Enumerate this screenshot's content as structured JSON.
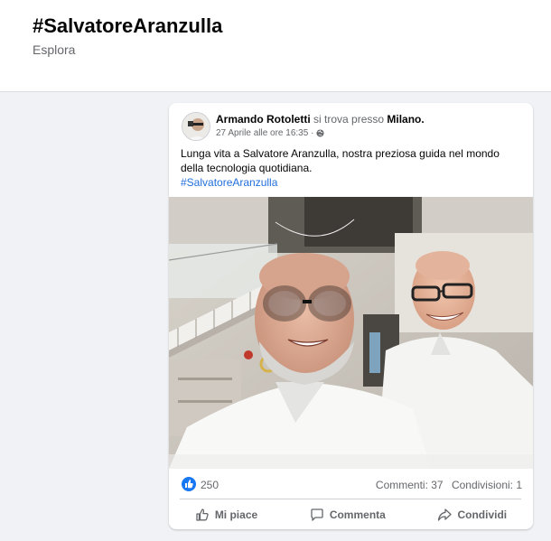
{
  "page": {
    "title": "#SalvatoreAranzulla",
    "subtitle": "Esplora"
  },
  "post": {
    "author": "Armando Rotoletti",
    "location_prefix": "si trova presso",
    "location": "Milano.",
    "timestamp": "27 Aprile alle ore 16:35 ·",
    "privacy_icon": "globe-icon",
    "text": "Lunga vita a Salvatore Aranzulla, nostra preziosa guida nel mondo della tecnologia quotidiana.",
    "hashtag": "#SalvatoreAranzulla",
    "photo_icon": "selfie-photo",
    "reactions_count": "250",
    "comments": "Commenti: 37",
    "shares": "Condivisioni: 1",
    "actions": {
      "like": "Mi piace",
      "comment": "Commenta",
      "share": "Condividi"
    }
  },
  "colors": {
    "background": "#f0f2f5",
    "card": "#ffffff",
    "link": "#216fdb",
    "like_blue": "#1877f2",
    "muted_text": "#65676b"
  }
}
